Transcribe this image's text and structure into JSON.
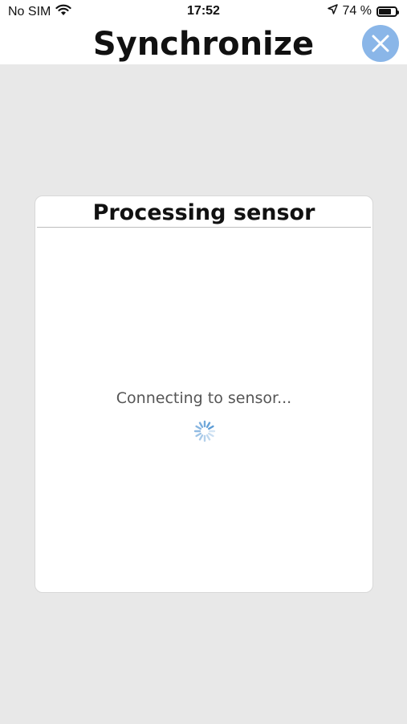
{
  "status_bar": {
    "carrier": "No SIM",
    "time": "17:52",
    "battery_text": "74 %",
    "battery_level": 0.74
  },
  "header": {
    "title": "Synchronize",
    "close_icon": "close-icon",
    "accent_color": "#8ab6e8"
  },
  "dialog": {
    "title": "Processing sensor",
    "message": "Connecting to sensor...",
    "spinner_icon": "loading-spinner-icon",
    "spinner_color": "#5b9bd5"
  }
}
